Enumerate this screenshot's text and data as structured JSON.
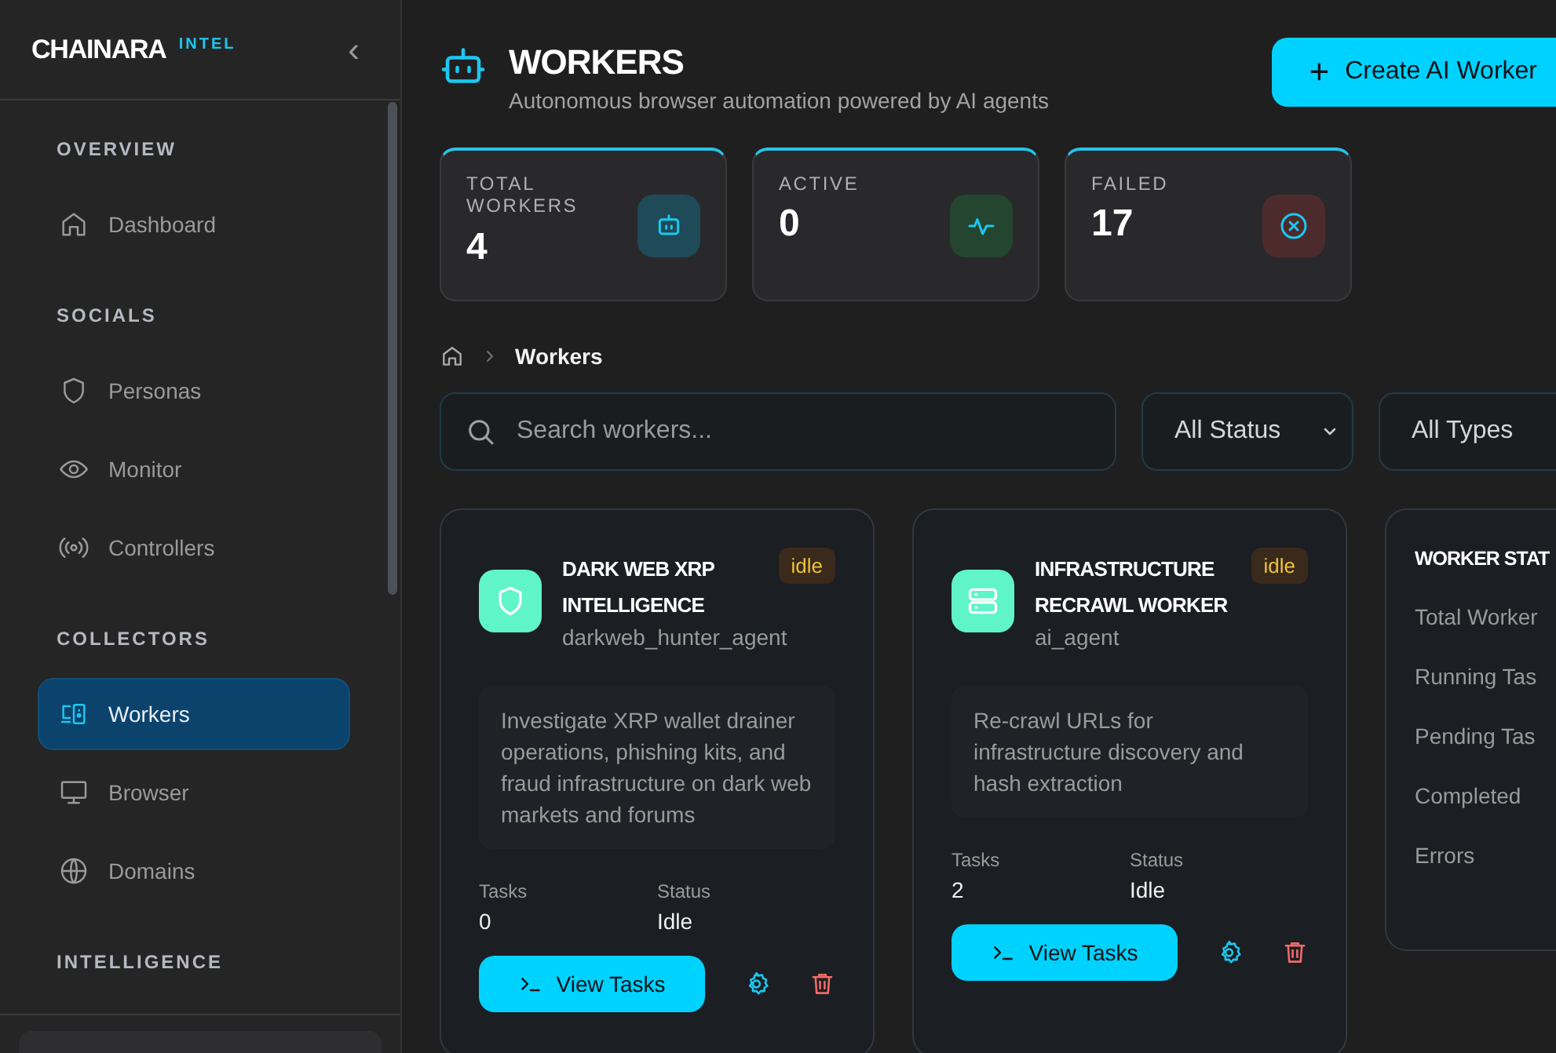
{
  "brand": {
    "name": "CHAINARA",
    "tag": "INTEL",
    "collapse": "‹"
  },
  "sidebar": {
    "sections": [
      {
        "title": "OVERVIEW",
        "items": [
          {
            "label": "Dashboard",
            "selected": false
          }
        ]
      },
      {
        "title": "SOCIALS",
        "items": [
          {
            "label": "Personas",
            "selected": false
          },
          {
            "label": "Monitor",
            "selected": false
          },
          {
            "label": "Controllers",
            "selected": false
          }
        ]
      },
      {
        "title": "COLLECTORS",
        "items": [
          {
            "label": "Workers",
            "selected": true
          },
          {
            "label": "Browser",
            "selected": false
          },
          {
            "label": "Domains",
            "selected": false
          }
        ]
      },
      {
        "title": "INTELLIGENCE"
      }
    ]
  },
  "header": {
    "title": "WORKERS",
    "subtitle": "Autonomous browser automation powered by AI agents",
    "button_icon": "+",
    "button": "Create AI Worker"
  },
  "stats": [
    {
      "label": "TOTAL WORKERS",
      "value": "4",
      "color": "#1f4a57"
    },
    {
      "label": "ACTIVE",
      "value": "0",
      "color": "#24452f"
    },
    {
      "label": "FAILED",
      "value": "17",
      "color": "#4d2b2c"
    }
  ],
  "breadcrumb": {
    "current": "Workers"
  },
  "filters": {
    "search": {
      "placeholder": "Search workers..."
    },
    "selects": [
      "All Status",
      "All Types"
    ]
  },
  "workers": [
    {
      "title": "DARK WEB XRP INTELLIGENCE",
      "agent": "darkweb_hunter_agent",
      "badge": "idle",
      "description": "Investigate XRP wallet drainer operations, phishing kits, and fraud infrastructure on dark web markets and forums",
      "tasks_label": "Tasks",
      "tasks": "0",
      "status_label": "Status",
      "status": "Idle",
      "button": "View Tasks"
    },
    {
      "title": "INFRASTRUCTURE RECRAWL WORKER",
      "agent": "ai_agent",
      "badge": "idle",
      "description": "Re-crawl URLs for infrastructure discovery and hash extraction",
      "tasks_label": "Tasks",
      "tasks": "2",
      "status_label": "Status",
      "status": "Idle",
      "button": "View Tasks"
    }
  ],
  "worker_stats": {
    "title": "WORKER STAT",
    "rows": [
      "Total Worker",
      "Running Tas",
      "Pending Tas",
      "Completed",
      "Errors"
    ]
  }
}
